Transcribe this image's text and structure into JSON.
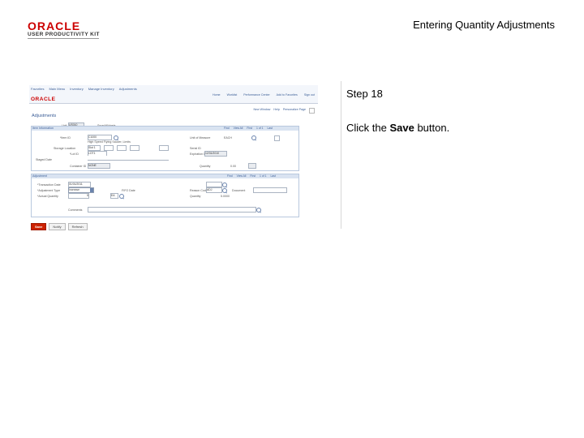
{
  "logo": {
    "word": "ORACLE",
    "sub": "USER PRODUCTIVITY KIT"
  },
  "slide": {
    "title": "Entering Quantity Adjustments",
    "step": "Step 18",
    "instruction_prefix": "Click the ",
    "instruction_bold": "Save",
    "instruction_suffix": " button."
  },
  "app": {
    "header_logo": "ORACLE",
    "breadcrumbs": [
      "Favorites",
      "Main Menu",
      "Inventory",
      "Manage Inventory",
      "Adjustments"
    ],
    "nav": [
      "Home",
      "Worklist",
      "Performance Center",
      "Add to Favorites",
      "Sign out"
    ],
    "subnav": [
      "New Window",
      "Help",
      "Personalize Page"
    ],
    "page_title": "Adjustments",
    "unit_label": "Unit",
    "unit_value": "US010",
    "unit_name": "SmartWidgets",
    "section1": {
      "title": "Item Information",
      "nav": [
        "Find",
        "View All",
        "First",
        "1 of 1",
        "Last"
      ]
    },
    "item_fields": {
      "item_id_label": "*Item ID",
      "item_id_value": "C1000",
      "item_desc": "High Speed Flying Saucer, Limits",
      "unit_measure_label": "Unit of Measure",
      "unit_measure_value": "EACH",
      "storage_area_label": "Storage Location",
      "storage_area_value": "Slot 1",
      "lot_label": "*Lot ID",
      "lot_value": "LOT1",
      "serial_label": "Serial ID",
      "expire_label": "Expiration Date",
      "expire_value": "12/31/2010",
      "staged_label": "Staged Date",
      "container_label": "Container ID",
      "container_value": "NONE",
      "qty_label": "Quantity",
      "qty_value": "0.00"
    },
    "section2": {
      "title": "Adjustment",
      "nav": [
        "Find",
        "View All",
        "First",
        "1 of 1",
        "Last"
      ]
    },
    "adj_fields": {
      "trans_date_label": "*Transaction Date",
      "trans_date_value": "01/01/2011",
      "adj_type_label": "*Adjustment Type",
      "adj_type_value": "Increase",
      "actual_qty_label": "*Actual Quantity",
      "actual_qty_value": "5",
      "uom_value": "EA",
      "fifo_label": "FIFO Date",
      "reason_label": "Reason Code",
      "reason_value": "ADJ",
      "doc_label": "Document",
      "qty_label": "Quantity",
      "qty_value": "5.0000",
      "comment_label": "Comments"
    },
    "buttons": {
      "save": "Save",
      "notify": "Notify",
      "refresh": "Refresh"
    }
  }
}
